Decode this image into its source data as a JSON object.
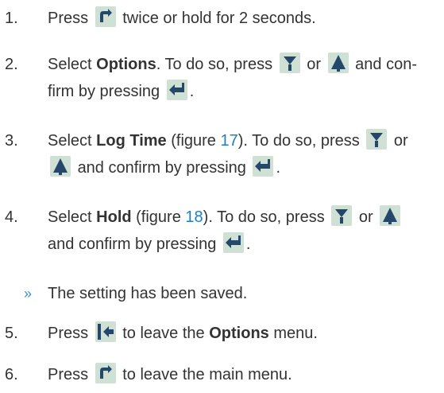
{
  "steps": [
    {
      "num": "1.",
      "a": "Press",
      "b": "twice or hold for 2 seconds."
    },
    {
      "num": "2.",
      "a": "Select",
      "bold": "Options",
      "b": ". To do so, press",
      "c": "or",
      "d": "and con-",
      "e": "firm by pressing",
      "f": "."
    },
    {
      "num": "3.",
      "a": "Select",
      "bold": "Log Time",
      "b": " (figure ",
      "link": "17",
      "c": "). To do so, press",
      "d": "or",
      "e": "and confirm by pressing",
      "f": "."
    },
    {
      "num": "4.",
      "a": "Select",
      "bold": "Hold",
      "b": " (figure ",
      "link": "18",
      "c": "). To do so, press",
      "d": "or",
      "e": "and confirm by pressing",
      "f": "."
    },
    {
      "num": "»",
      "a": "The setting has been saved."
    },
    {
      "num": "5.",
      "a": "Press",
      "b": "to leave the",
      "bold": "Options",
      "c": "menu."
    },
    {
      "num": "6.",
      "a": "Press",
      "b": "to leave the main menu."
    }
  ],
  "icons": {
    "menu": "menu-rotate-icon",
    "down": "arrow-down-icon",
    "up": "arrow-up-icon",
    "enter": "enter-icon",
    "back": "back-icon"
  },
  "colors": {
    "text": "#333333",
    "link": "#1b80c3",
    "bullet": "#3a8fd0",
    "icon_bg": "#cfe0d4",
    "icon_fg": "#24476a"
  }
}
